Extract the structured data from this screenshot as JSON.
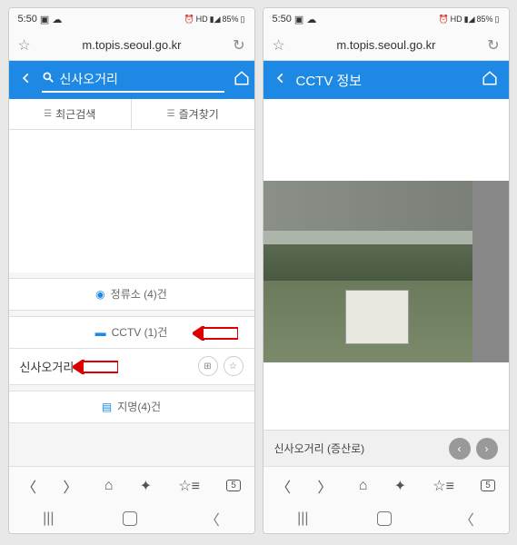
{
  "status": {
    "time": "5:50",
    "battery": "85%",
    "indicators": "HD"
  },
  "url": "m.topis.seoul.go.kr",
  "left": {
    "search_value": "신사오거리",
    "tabs": {
      "recent": "최근검색",
      "favorite": "즐겨찾기"
    },
    "cat_stop": "정류소 (4)건",
    "cat_cctv": "CCTV (1)건",
    "cat_place": "지명(4)건",
    "result_name": "신사오거리"
  },
  "right": {
    "header_title": "CCTV 정보",
    "footer_label": "신사오거리 (증산로)"
  }
}
